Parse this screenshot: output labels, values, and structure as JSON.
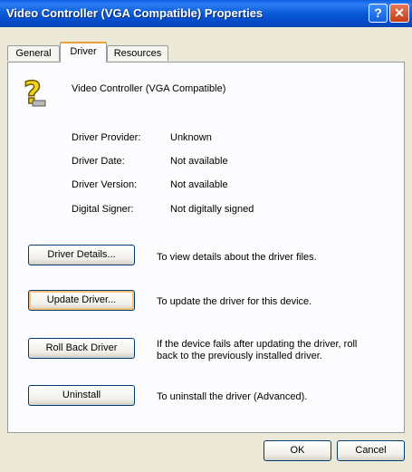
{
  "window": {
    "title": "Video Controller (VGA Compatible) Properties",
    "help_label": "?",
    "close_label": "✕"
  },
  "tabs": [
    {
      "label": "General",
      "active": false
    },
    {
      "label": "Driver",
      "active": true
    },
    {
      "label": "Resources",
      "active": false
    }
  ],
  "device": {
    "icon": "unknown-device-question-icon",
    "name": "Video Controller (VGA Compatible)"
  },
  "info": {
    "provider_label": "Driver Provider:",
    "provider_value": "Unknown",
    "date_label": "Driver Date:",
    "date_value": "Not available",
    "version_label": "Driver Version:",
    "version_value": "Not available",
    "signer_label": "Digital Signer:",
    "signer_value": "Not digitally signed"
  },
  "actions": {
    "details_label": "Driver Details...",
    "details_desc": "To view details about the driver files.",
    "update_label": "Update Driver...",
    "update_desc": "To update the driver for this device.",
    "rollback_label": "Roll Back Driver",
    "rollback_desc_line1": "If the device fails after updating the driver, roll",
    "rollback_desc_line2": "back to the previously installed driver.",
    "uninstall_label": "Uninstall",
    "uninstall_desc": "To uninstall the driver (Advanced)."
  },
  "footer": {
    "ok_label": "OK",
    "cancel_label": "Cancel"
  }
}
